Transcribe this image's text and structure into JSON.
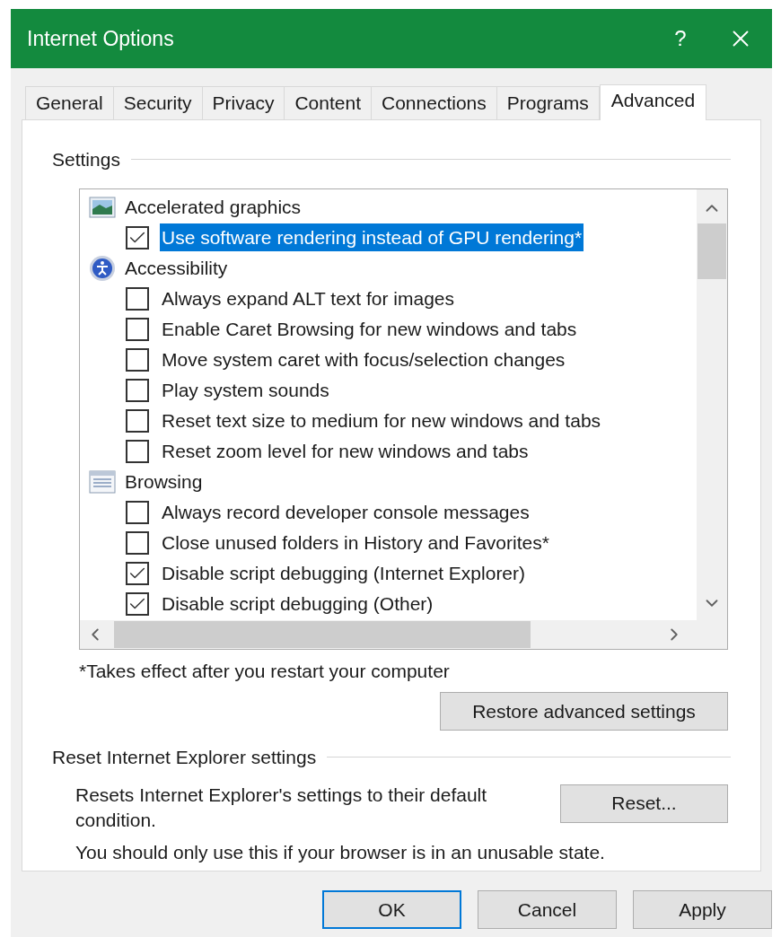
{
  "window": {
    "title": "Internet Options",
    "help_button": "?"
  },
  "tabs": [
    {
      "label": "General",
      "selected": false
    },
    {
      "label": "Security",
      "selected": false
    },
    {
      "label": "Privacy",
      "selected": false
    },
    {
      "label": "Content",
      "selected": false
    },
    {
      "label": "Connections",
      "selected": false
    },
    {
      "label": "Programs",
      "selected": false
    },
    {
      "label": "Advanced",
      "selected": true
    }
  ],
  "settings": {
    "label": "Settings",
    "groups": [
      {
        "kind": "graphics",
        "label": "Accelerated graphics",
        "items": [
          {
            "label": "Use software rendering instead of GPU rendering*",
            "checked": true,
            "selected": true
          }
        ]
      },
      {
        "kind": "accessibility",
        "label": "Accessibility",
        "items": [
          {
            "label": "Always expand ALT text for images",
            "checked": false,
            "selected": false
          },
          {
            "label": "Enable Caret Browsing for new windows and tabs",
            "checked": false,
            "selected": false
          },
          {
            "label": "Move system caret with focus/selection changes",
            "checked": false,
            "selected": false
          },
          {
            "label": "Play system sounds",
            "checked": false,
            "selected": false
          },
          {
            "label": "Reset text size to medium for new windows and tabs",
            "checked": false,
            "selected": false
          },
          {
            "label": "Reset zoom level for new windows and tabs",
            "checked": false,
            "selected": false
          }
        ]
      },
      {
        "kind": "browsing",
        "label": "Browsing",
        "items": [
          {
            "label": "Always record developer console messages",
            "checked": false,
            "selected": false
          },
          {
            "label": "Close unused folders in History and Favorites*",
            "checked": false,
            "selected": false
          },
          {
            "label": "Disable script debugging (Internet Explorer)",
            "checked": true,
            "selected": false
          },
          {
            "label": "Disable script debugging (Other)",
            "checked": true,
            "selected": false
          }
        ]
      }
    ],
    "note": "*Takes effect after you restart your computer",
    "restore_button": "Restore advanced settings"
  },
  "reset_section": {
    "label": "Reset Internet Explorer settings",
    "description": "Resets Internet Explorer's settings to their default condition.",
    "reset_button": "Reset...",
    "warning": "You should only use this if your browser is in an unusable state."
  },
  "buttons": [
    {
      "label": "OK",
      "default": true
    },
    {
      "label": "Cancel",
      "default": false
    },
    {
      "label": "Apply",
      "default": false
    }
  ]
}
